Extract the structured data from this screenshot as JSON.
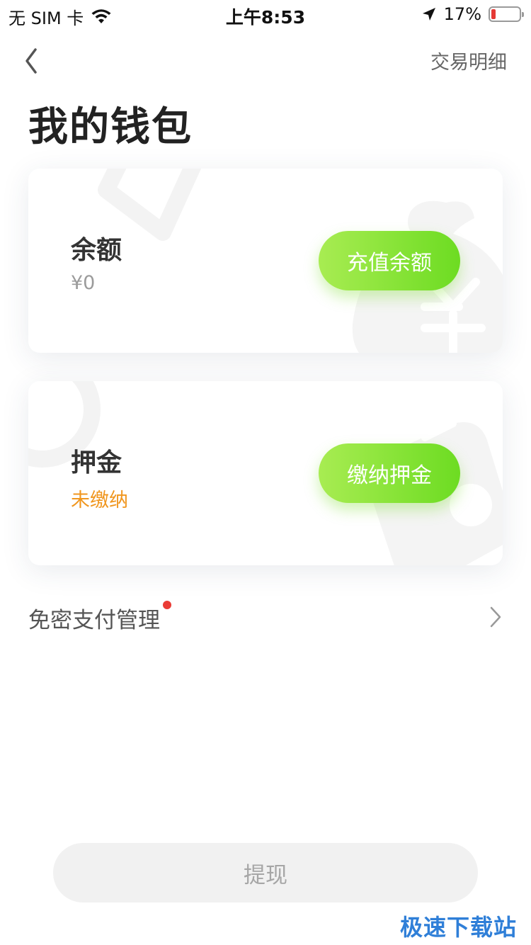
{
  "status_bar": {
    "carrier": "无 SIM 卡",
    "time": "上午8:53",
    "battery": "17%",
    "battery_level_fraction": 0.17,
    "battery_color": "#e53935"
  },
  "nav": {
    "back_icon": "chevron-left-icon",
    "transactions_label": "交易明细"
  },
  "page": {
    "title": "我的钱包"
  },
  "balance_card": {
    "title": "余额",
    "value": "¥0",
    "button_label": "充值余额",
    "background_icon": "money-bag-icon"
  },
  "deposit_card": {
    "title": "押金",
    "status": "未缴纳",
    "status_color": "#f0961e",
    "button_label": "缴纳押金",
    "background_icon": "bike-icon"
  },
  "settings": {
    "password_free_label": "免密支付管理",
    "has_notification_dot": true,
    "chevron_icon": "chevron-right-icon"
  },
  "footer": {
    "withdraw_label": "提现",
    "watermark": "极速下载站"
  },
  "colors": {
    "accent_green": "#6ddc22",
    "accent_green_light": "#a8ec52",
    "notification_red": "#ea3b35"
  }
}
